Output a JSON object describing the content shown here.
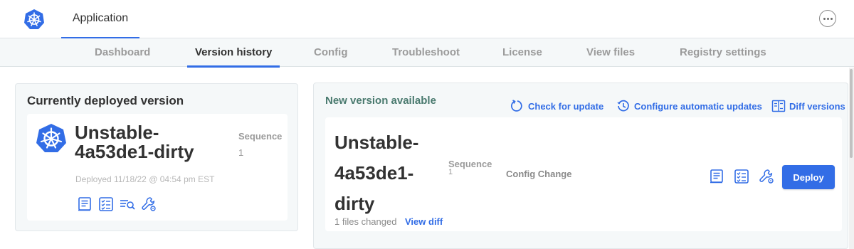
{
  "header": {
    "app_tab_label": "Application",
    "logo_icon": "kubernetes-helm-icon",
    "more_icon": "more-options-icon"
  },
  "subnav": {
    "items": [
      {
        "label": "Dashboard",
        "active": false
      },
      {
        "label": "Version history",
        "active": true
      },
      {
        "label": "Config",
        "active": false
      },
      {
        "label": "Troubleshoot",
        "active": false
      },
      {
        "label": "License",
        "active": false
      },
      {
        "label": "View files",
        "active": false
      },
      {
        "label": "Registry settings",
        "active": false
      }
    ]
  },
  "current": {
    "title": "Currently deployed version",
    "version_line1": "Unstable-",
    "version_line2": "4a53de1-dirty",
    "sequence_label": "Sequence",
    "sequence_value": "1",
    "deployed_text": "Deployed 11/18/22 @ 04:54 pm EST",
    "icons": [
      "release-notes-icon",
      "preflight-checklist-icon",
      "view-logs-icon",
      "edit-config-icon"
    ]
  },
  "new_version": {
    "title": "New version available",
    "check_update_label": "Check for update",
    "configure_updates_label": "Configure automatic updates",
    "diff_versions_label": "Diff versions",
    "version_line1": "Unstable-",
    "version_line2": "4a53de1-",
    "version_line3": "dirty",
    "sequence_label": "Sequence",
    "sequence_value": "1",
    "config_change_label": "Config Change",
    "files_changed": "1 files changed",
    "view_diff_label": "View diff",
    "deploy_label": "Deploy",
    "icons": [
      "release-notes-icon",
      "preflight-checklist-icon",
      "edit-config-icon"
    ]
  },
  "colors": {
    "accent": "#326de6",
    "card_bg": "#f5f8f9",
    "new_title": "#4a7a6f"
  }
}
